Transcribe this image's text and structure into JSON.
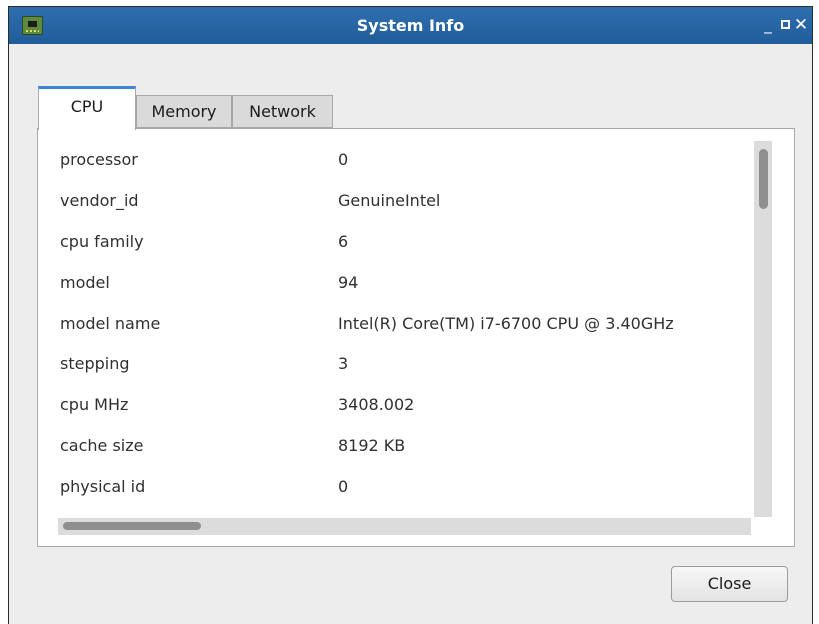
{
  "window": {
    "title": "System Info",
    "controls": {
      "minimize": "_",
      "close": "✕"
    }
  },
  "app_icon": "system-info-chip-icon",
  "tabs": [
    {
      "label": "CPU",
      "active": true
    },
    {
      "label": "Memory",
      "active": false
    },
    {
      "label": "Network",
      "active": false
    }
  ],
  "cpu_info": [
    {
      "key": "processor",
      "value": "0"
    },
    {
      "key": "vendor_id",
      "value": "GenuineIntel"
    },
    {
      "key": "cpu family",
      "value": "6"
    },
    {
      "key": "model",
      "value": "94"
    },
    {
      "key": "model name",
      "value": "Intel(R) Core(TM) i7-6700 CPU @ 3.40GHz"
    },
    {
      "key": "stepping",
      "value": "3"
    },
    {
      "key": "cpu MHz",
      "value": "3408.002"
    },
    {
      "key": "cache size",
      "value": "8192 KB"
    },
    {
      "key": "physical id",
      "value": "0"
    }
  ],
  "buttons": {
    "close": "Close"
  },
  "colors": {
    "titlebar": "#2466a5",
    "tab_accent": "#3b86d6"
  }
}
